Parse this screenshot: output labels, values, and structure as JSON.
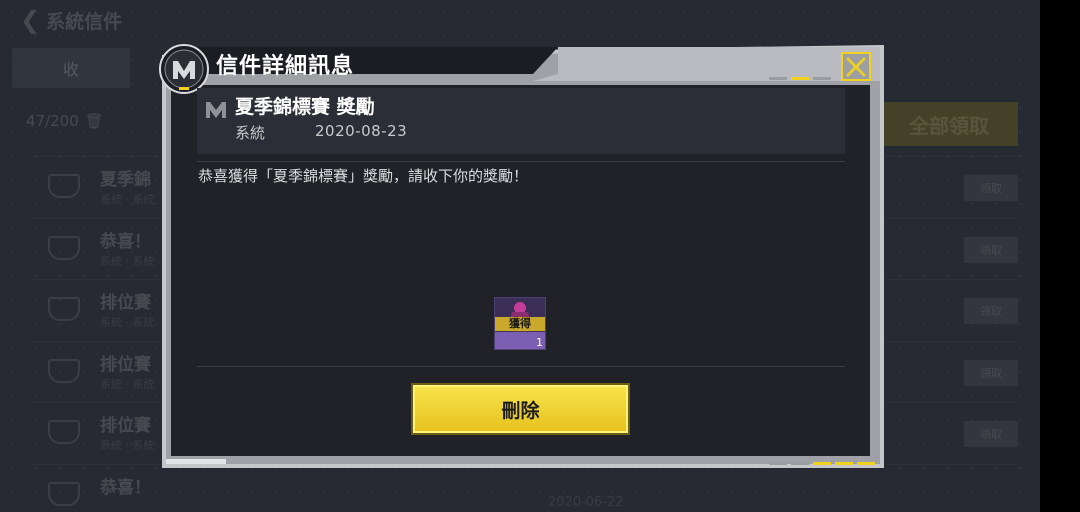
{
  "background": {
    "title": "系統信件",
    "tab_label": "收",
    "mail_count": "47/200",
    "claim_all_label": "全部領取",
    "rows": [
      {
        "title": "夏季錦",
        "sub": "系統 · 系統",
        "date": "",
        "button": "領取"
      },
      {
        "title": "恭喜！",
        "sub": "系統 · 系統",
        "date": "",
        "button": "領取"
      },
      {
        "title": "排位賽",
        "sub": "系統 · 系統",
        "date": "",
        "button": "領取"
      },
      {
        "title": "排位賽",
        "sub": "系統 · 系統",
        "date": "",
        "button": "領取"
      },
      {
        "title": "排位賽",
        "sub": "系統 · 系統",
        "date": "",
        "button": "領取"
      },
      {
        "title": "恭喜！",
        "sub": "",
        "date": "2020-06-22",
        "button": ""
      }
    ]
  },
  "modal": {
    "title": "信件詳細訊息",
    "mail": {
      "title": "夏季錦標賽 獎勵",
      "sender": "系統",
      "date": "2020-08-23",
      "body": "恭喜獲得「夏季錦標賽」獎勵，請收下你的獎勵！"
    },
    "reward": {
      "label": "獲得",
      "quantity": "1"
    },
    "delete_label": "刪除"
  },
  "icons": {
    "badge": "cod-emblem-icon",
    "close": "close-icon",
    "back": "back-arrow-icon",
    "trash": "trash-icon",
    "mail": "mail-emblem-icon"
  },
  "colors": {
    "accent": "#f1d21f",
    "panel": "#202228",
    "frame": "#c8c9cc"
  }
}
